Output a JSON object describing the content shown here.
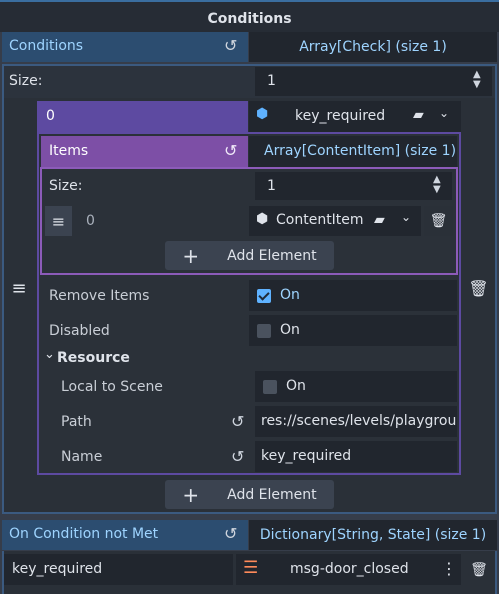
{
  "section_title": "Conditions",
  "conditions": {
    "label": "Conditions",
    "value": "Array[Check] (size 1)",
    "size_label": "Size:",
    "size_value": "1",
    "element_index": "0",
    "element_resource": "key_required",
    "add_element_label": "Add Element"
  },
  "items": {
    "label": "Items",
    "value": "Array[ContentItem] (size 1)",
    "size_label": "Size:",
    "size_value": "1",
    "element_index": "0",
    "element_resource": "ContentItem",
    "add_element_label": "Add Element"
  },
  "remove_items": {
    "label": "Remove Items",
    "value": "On",
    "checked": true
  },
  "disabled": {
    "label": "Disabled",
    "value": "On",
    "checked": false
  },
  "resource": {
    "label": "Resource",
    "local_to_scene": {
      "label": "Local to Scene",
      "value": "On",
      "checked": false
    },
    "path": {
      "label": "Path",
      "value": "res://scenes/levels/playgrou"
    },
    "name": {
      "label": "Name",
      "value": "key_required"
    }
  },
  "on_condition_not_met": {
    "label": "On Condition not Met",
    "value": "Dictionary[String, State] (size 1)",
    "key": "key_required",
    "entry_value": "msg-door_closed"
  },
  "colors": {
    "accent_blue": "#9ed4ff",
    "header_blue": "#2c4d70",
    "header_purple": "#7d4fa6",
    "header_violet": "#5d4aa1",
    "check_on": "#5fb2ff"
  }
}
